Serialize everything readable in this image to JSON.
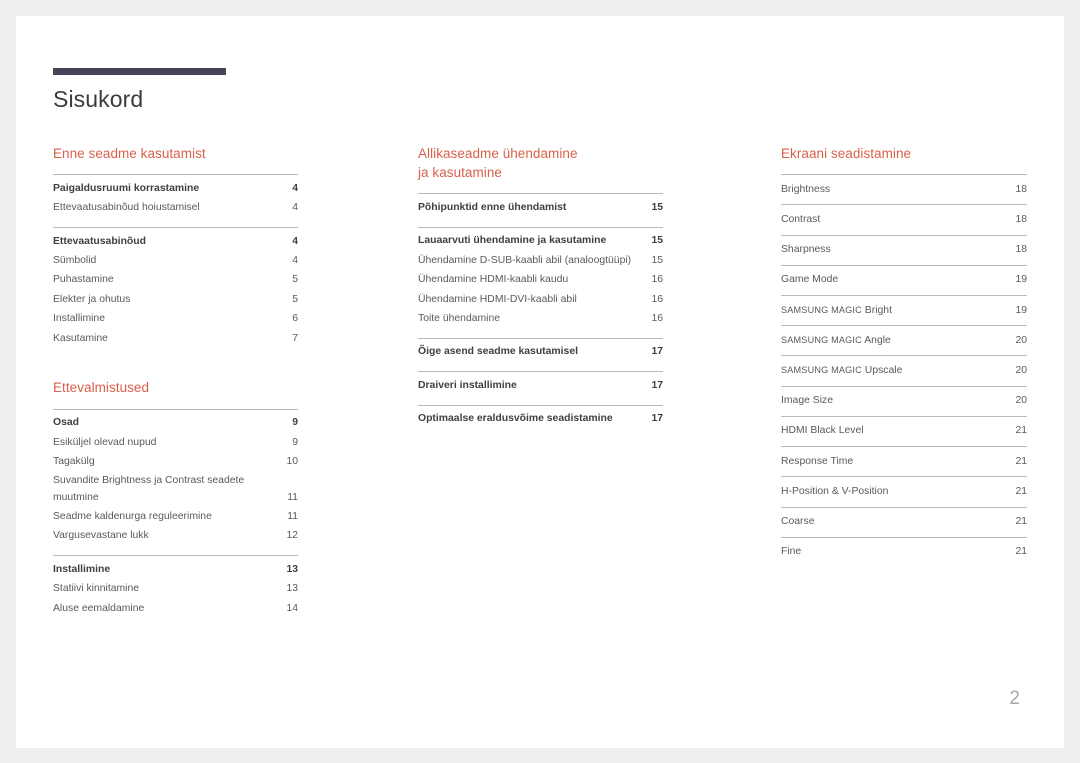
{
  "document": {
    "title": "Sisukord",
    "page_number": "2",
    "accent_color": "#d9614c",
    "rule_color": "#474457"
  },
  "columns": [
    {
      "name": "column-left",
      "sections": [
        {
          "heading": "Enne seadme kasutamist",
          "groups": [
            {
              "entries": [
                {
                  "label": "Paigaldusruumi korrastamine",
                  "page": "4",
                  "bold": true
                },
                {
                  "label": "Ettevaatusabinõud hoiustamisel",
                  "page": "4",
                  "bold": false
                }
              ]
            },
            {
              "entries": [
                {
                  "label": "Ettevaatusabinõud",
                  "page": "4",
                  "bold": true
                },
                {
                  "label": "Sümbolid",
                  "page": "4",
                  "bold": false
                },
                {
                  "label": "Puhastamine",
                  "page": "5",
                  "bold": false
                },
                {
                  "label": "Elekter ja ohutus",
                  "page": "5",
                  "bold": false
                },
                {
                  "label": "Installimine",
                  "page": "6",
                  "bold": false
                },
                {
                  "label": "Kasutamine",
                  "page": "7",
                  "bold": false
                }
              ]
            }
          ]
        },
        {
          "heading": "Ettevalmistused",
          "groups": [
            {
              "entries": [
                {
                  "label": "Osad",
                  "page": "9",
                  "bold": true
                },
                {
                  "label": "Esiküljel olevad nupud",
                  "page": "9",
                  "bold": false
                },
                {
                  "label": "Tagakülg",
                  "page": "10",
                  "bold": false
                },
                {
                  "label": "Suvandite Brightness ja Contrast seadete muutmine",
                  "page": "11",
                  "bold": false
                },
                {
                  "label": "Seadme kaldenurga reguleerimine",
                  "page": "11",
                  "bold": false
                },
                {
                  "label": "Vargusevastane lukk",
                  "page": "12",
                  "bold": false
                }
              ]
            },
            {
              "entries": [
                {
                  "label": "Installimine",
                  "page": "13",
                  "bold": true
                },
                {
                  "label": "Statiivi kinnitamine",
                  "page": "13",
                  "bold": false
                },
                {
                  "label": "Aluse eemaldamine",
                  "page": "14",
                  "bold": false
                }
              ]
            }
          ]
        }
      ]
    },
    {
      "name": "column-middle",
      "sections": [
        {
          "heading": "Allikaseadme ühendamine\nja kasutamine",
          "groups": [
            {
              "entries": [
                {
                  "label": "Põhipunktid enne ühendamist",
                  "page": "15",
                  "bold": true
                }
              ]
            },
            {
              "entries": [
                {
                  "label": "Lauaarvuti ühendamine ja kasutamine",
                  "page": "15",
                  "bold": true
                },
                {
                  "label": "Ühendamine D-SUB-kaabli abil (analoogtüüpi)",
                  "page": "15",
                  "bold": false
                },
                {
                  "label": "Ühendamine HDMI-kaabli kaudu",
                  "page": "16",
                  "bold": false
                },
                {
                  "label": "Ühendamine HDMI-DVI-kaabli abil",
                  "page": "16",
                  "bold": false
                },
                {
                  "label": "Toite ühendamine",
                  "page": "16",
                  "bold": false
                }
              ]
            },
            {
              "entries": [
                {
                  "label": "Õige asend seadme kasutamisel",
                  "page": "17",
                  "bold": true
                }
              ]
            },
            {
              "entries": [
                {
                  "label": "Draiveri installimine",
                  "page": "17",
                  "bold": true
                }
              ]
            },
            {
              "entries": [
                {
                  "label": "Optimaalse eraldusvõime seadistamine",
                  "page": "17",
                  "bold": true
                }
              ]
            }
          ]
        }
      ]
    },
    {
      "name": "column-right",
      "sections": [
        {
          "heading": "Ekraani seadistamine",
          "rows": [
            {
              "label": "Brightness",
              "page": "18"
            },
            {
              "label": "Contrast",
              "page": "18"
            },
            {
              "label": "Sharpness",
              "page": "18"
            },
            {
              "label": "Game Mode",
              "page": "19"
            },
            {
              "label": "SAMSUNG MAGIC Bright",
              "page": "19",
              "magic": true,
              "magic_prefix": "SAMSUNG MAGIC",
              "magic_suffix": "Bright"
            },
            {
              "label": "SAMSUNG MAGIC Angle",
              "page": "20",
              "magic": true,
              "magic_prefix": "SAMSUNG MAGIC",
              "magic_suffix": "Angle"
            },
            {
              "label": "SAMSUNG MAGIC Upscale",
              "page": "20",
              "magic": true,
              "magic_prefix": "SAMSUNG MAGIC",
              "magic_suffix": "Upscale"
            },
            {
              "label": "Image Size",
              "page": "20"
            },
            {
              "label": "HDMI Black Level",
              "page": "21"
            },
            {
              "label": "Response Time",
              "page": "21"
            },
            {
              "label": "H-Position & V-Position",
              "page": "21"
            },
            {
              "label": "Coarse",
              "page": "21"
            },
            {
              "label": "Fine",
              "page": "21"
            }
          ]
        }
      ]
    }
  ]
}
